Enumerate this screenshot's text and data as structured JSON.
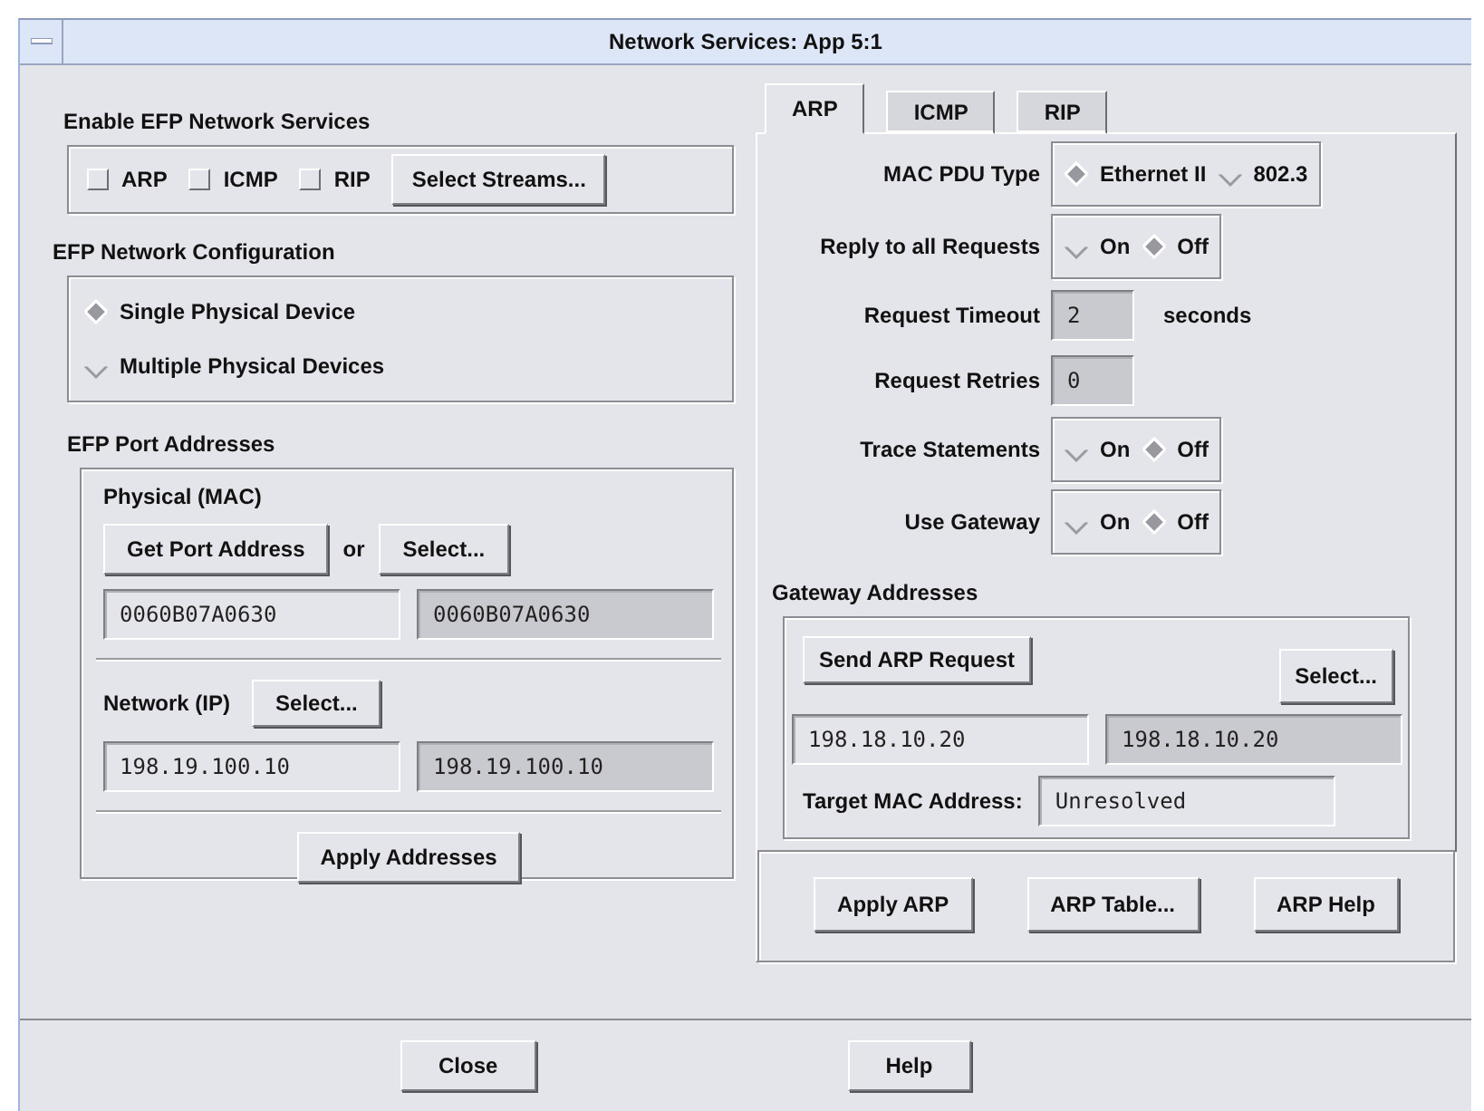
{
  "window": {
    "title": "Network Services: App 5:1"
  },
  "enable_services": {
    "title": "Enable EFP Network Services",
    "checkboxes": [
      {
        "label": "ARP",
        "checked": false
      },
      {
        "label": "ICMP",
        "checked": false
      },
      {
        "label": "RIP",
        "checked": false
      }
    ],
    "button": "Select Streams..."
  },
  "network_configuration": {
    "title": "EFP Network Configuration",
    "options": [
      {
        "label": "Single Physical Device",
        "selected": true
      },
      {
        "label": "Multiple Physical Devices",
        "selected": false
      }
    ]
  },
  "port_addresses": {
    "title": "EFP Port Addresses",
    "physical": {
      "label": "Physical (MAC)",
      "get_button": "Get Port Address",
      "or": "or",
      "select_button": "Select...",
      "fields": [
        {
          "value": "0060B07A0630",
          "editable": true
        },
        {
          "value": "0060B07A0630",
          "editable": false
        }
      ]
    },
    "network": {
      "label": "Network (IP)",
      "select_button": "Select...",
      "fields": [
        {
          "value": "198.19.100.10",
          "editable": true
        },
        {
          "value": "198.19.100.10",
          "editable": false
        }
      ]
    },
    "apply_button": "Apply Addresses"
  },
  "tabs": [
    {
      "label": "ARP",
      "selected": true
    },
    {
      "label": "ICMP",
      "selected": false
    },
    {
      "label": "RIP",
      "selected": false
    }
  ],
  "arp_settings": [
    {
      "kind": "radio",
      "label": "MAC PDU Type",
      "options": [
        {
          "label": "Ethernet II",
          "selected": true
        },
        {
          "label": "802.3",
          "selected": false
        }
      ]
    },
    {
      "kind": "radio",
      "label": "Reply to all Requests",
      "options": [
        {
          "label": "On",
          "selected": false
        },
        {
          "label": "Off",
          "selected": true
        }
      ]
    },
    {
      "kind": "field",
      "label": "Request Timeout",
      "value": "2",
      "editable": false,
      "unit": "seconds"
    },
    {
      "kind": "field",
      "label": "Request Retries",
      "value": "0",
      "editable": false
    },
    {
      "kind": "radio",
      "label": "Trace Statements",
      "options": [
        {
          "label": "On",
          "selected": false
        },
        {
          "label": "Off",
          "selected": true
        }
      ]
    },
    {
      "kind": "radio",
      "label": "Use Gateway",
      "options": [
        {
          "label": "On",
          "selected": false
        },
        {
          "label": "Off",
          "selected": true
        }
      ]
    }
  ],
  "gateway_addresses": {
    "title": "Gateway Addresses",
    "send_button": "Send ARP Request",
    "select_button": "Select...",
    "fields": [
      {
        "value": "198.18.10.20",
        "editable": true
      },
      {
        "value": "198.18.10.20",
        "editable": false
      }
    ],
    "target_label": "Target MAC Address:",
    "target_field": {
      "value": "Unresolved",
      "editable": true
    }
  },
  "arp_buttons": [
    "Apply ARP",
    "ARP Table...",
    "ARP Help"
  ],
  "footer_buttons": [
    "Close",
    "Help"
  ]
}
